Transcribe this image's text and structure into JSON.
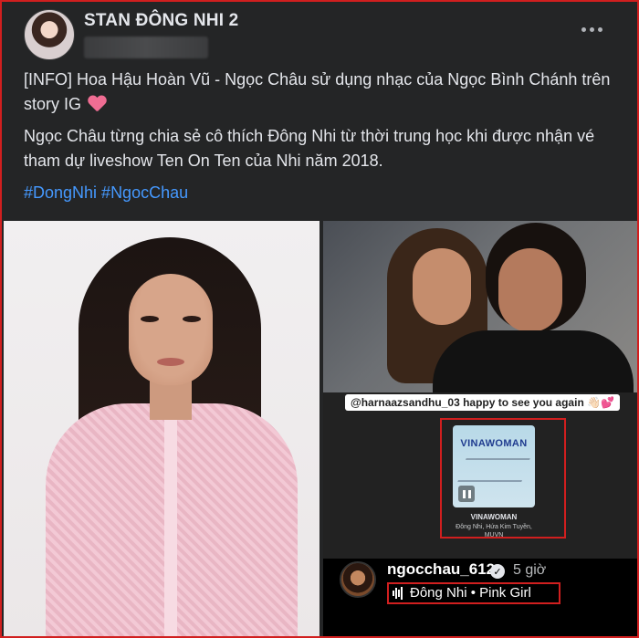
{
  "post": {
    "page_name": "STAN ĐÔNG NHI 2",
    "paragraph1": "[INFO] Hoa Hậu Hoàn Vũ - Ngọc Châu sử dụng nhạc của Ngọc Bình Chánh trên story IG",
    "paragraph2": "Ngọc Châu từng chia sẻ cô thích Đông Nhi từ thời trung học khi được nhận vé tham dự liveshow Ten On Ten của Nhi năm 2018.",
    "hashtags": "#DongNhi #NgocChau"
  },
  "story": {
    "mention": "@harnaazsandhu_03 happy to see you again 👋🏻💕",
    "album_cover_title": "VINAWOMAN",
    "album_name": "VINAWOMAN",
    "album_artists": "Đông Nhi, Hứa Kim Tuyền, MUVN",
    "username": "ngocchau_612",
    "time": "5 giờ",
    "song": "Đông Nhi • Pink Girl"
  },
  "colors": {
    "highlight_border": "#d11f1f",
    "hashtag": "#4599ff",
    "background": "#242526"
  },
  "icons": [
    "more-options-icon",
    "heart-icon",
    "pause-icon",
    "verified-icon",
    "audio-wave-icon"
  ]
}
